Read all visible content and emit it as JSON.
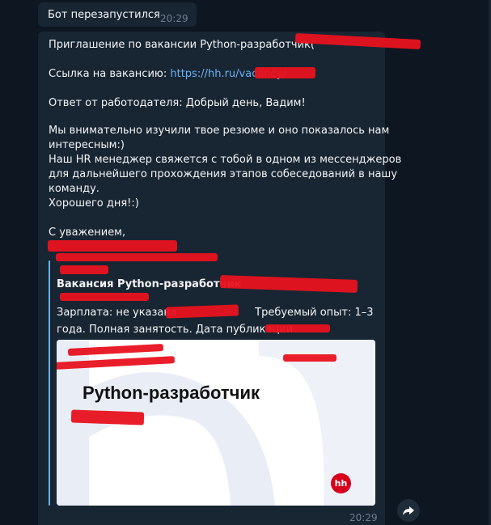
{
  "messages": [
    {
      "text": "Бот перезапустился",
      "time": "20:29"
    },
    {
      "invitation": "Приглашение по вакансии Python-разработчик(",
      "link_label": "Ссылка на вакансию:",
      "link_text": "https://hh.ru/vacancy/",
      "employer_reply": "Ответ от работодателя: Добрый день, Вадим!",
      "body": [
        "Мы внимательно изучили твое резюме и оно показалось нам",
        "интересным:)",
        "Наш HR менеджер свяжется с тобой в одном из мессенджеров",
        "для дальнейшего прохождения этапов собеседований в нашу",
        "команду.",
        "Хорошего дня!:)"
      ],
      "signature": "С уважением,",
      "preview": {
        "title": "Вакансия Python-разработчик",
        "desc_line1_a": "Зарплата: не указана",
        "desc_line1_b": "Требуемый опыт: 1–3",
        "desc_line2": "года. Полная занятость. Дата публикации",
        "image_title": "Python-разработчик",
        "logo_text": "hh"
      },
      "time": "20:29"
    }
  ],
  "colors": {
    "background": "#0e1621",
    "bubble": "#182533",
    "link": "#6ab3f3",
    "redaction": "#e8121f"
  },
  "icons": {
    "share": "share-arrow-icon",
    "logo": "hh-logo-icon"
  }
}
